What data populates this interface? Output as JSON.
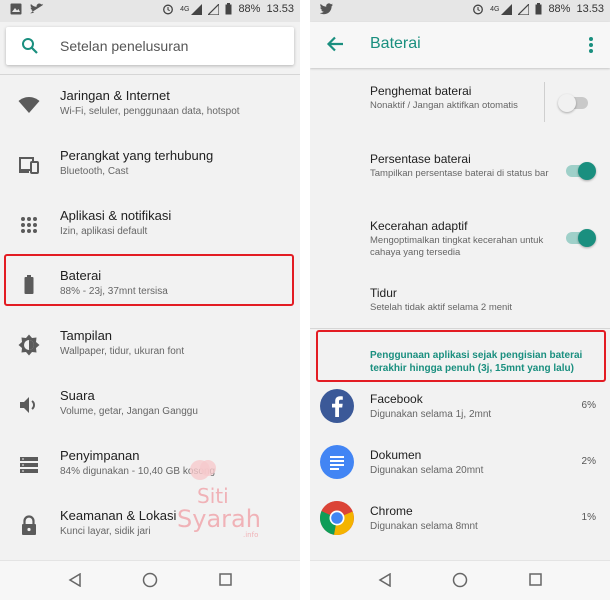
{
  "status": {
    "battery_pct": "88%",
    "time": "13.53",
    "network": "4G"
  },
  "left": {
    "search": {
      "placeholder": "Setelan penelusuran"
    },
    "items": [
      {
        "title": "Jaringan & Internet",
        "subtitle": "Wi-Fi, seluler, penggunaan data, hotspot",
        "icon": "wifi-icon"
      },
      {
        "title": "Perangkat yang terhubung",
        "subtitle": "Bluetooth, Cast",
        "icon": "devices-icon"
      },
      {
        "title": "Aplikasi & notifikasi",
        "subtitle": "Izin, aplikasi default",
        "icon": "apps-grid-icon"
      },
      {
        "title": "Baterai",
        "subtitle": "88% - 23j, 37mnt tersisa",
        "icon": "battery-icon"
      },
      {
        "title": "Tampilan",
        "subtitle": "Wallpaper, tidur, ukuran font",
        "icon": "brightness-icon"
      },
      {
        "title": "Suara",
        "subtitle": "Volume, getar, Jangan Ganggu",
        "icon": "speaker-icon"
      },
      {
        "title": "Penyimpanan",
        "subtitle": "84% digunakan - 10,40 GB kosong",
        "icon": "storage-icon"
      },
      {
        "title": "Keamanan & Lokasi",
        "subtitle": "Kunci layar, sidik jari",
        "icon": "lock-icon"
      }
    ]
  },
  "right": {
    "title": "Baterai",
    "prefs": [
      {
        "title": "Penghemat baterai",
        "subtitle": "Nonaktif / Jangan aktifkan otomatis",
        "on": false
      },
      {
        "title": "Persentase baterai",
        "subtitle": "Tampilkan persentase baterai di status bar",
        "on": true
      },
      {
        "title": "Kecerahan adaptif",
        "subtitle": "Mengoptimalkan tingkat kecerahan untuk cahaya yang tersedia",
        "on": true
      },
      {
        "title": "Tidur",
        "subtitle": "Setelah tidak aktif selama 2 menit"
      }
    ],
    "usage_header": "Penggunaan aplikasi sejak pengisian baterai terakhir hingga penuh (3j, 15mnt yang lalu)",
    "apps": [
      {
        "name": "Facebook",
        "usage": "Digunakan selama 1j, 2mnt",
        "percent": "6%",
        "icon": "facebook-icon"
      },
      {
        "name": "Dokumen",
        "usage": "Digunakan selama 20mnt",
        "percent": "2%",
        "icon": "docs-icon"
      },
      {
        "name": "Chrome",
        "usage": "Digunakan selama 8mnt",
        "percent": "1%",
        "icon": "chrome-icon"
      }
    ]
  },
  "watermark": {
    "line1": "Siti",
    "line2": "Syarah",
    "line3": ".info"
  },
  "colors": {
    "accent": "#1a8f7f",
    "highlight": "#e31c23",
    "toggle_on": "#1a8f7f",
    "toggle_off": "#f1f1f1"
  }
}
